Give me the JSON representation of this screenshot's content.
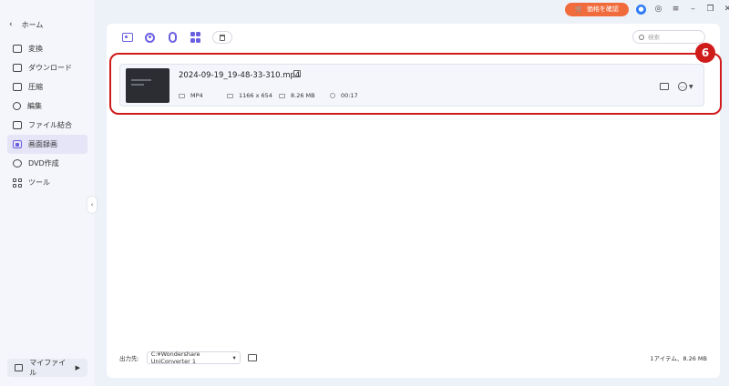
{
  "sidebar": {
    "home_label": "ホーム",
    "items": [
      {
        "label": "変換",
        "icon": "convert-icon"
      },
      {
        "label": "ダウンロード",
        "icon": "download-icon"
      },
      {
        "label": "圧縮",
        "icon": "compress-icon"
      },
      {
        "label": "編集",
        "icon": "scissors-icon"
      },
      {
        "label": "ファイル結合",
        "icon": "merge-icon"
      },
      {
        "label": "画面録画",
        "icon": "screen-record-icon",
        "active": true
      },
      {
        "label": "DVD作成",
        "icon": "disc-icon"
      },
      {
        "label": "ツール",
        "icon": "tools-icon"
      }
    ],
    "my_files_label": "マイファイル"
  },
  "topbar": {
    "price_button_label": "価格を確認"
  },
  "search": {
    "placeholder": "検索"
  },
  "file": {
    "name": "2024-09-19_19-48-33-310.mp4",
    "format": "MP4",
    "resolution": "1166 x 654",
    "size": "8.26 MB",
    "duration": "00:17"
  },
  "annotation": {
    "badge": "6"
  },
  "bottom": {
    "output_label": "出力先:",
    "output_path": "C:¥Wondershare UniConverter 1",
    "summary": "1アイテム、8.26 MB"
  },
  "colors": {
    "accent": "#6a5fe0",
    "price_button": "#f06c3c",
    "annotation": "#d01b1b"
  }
}
